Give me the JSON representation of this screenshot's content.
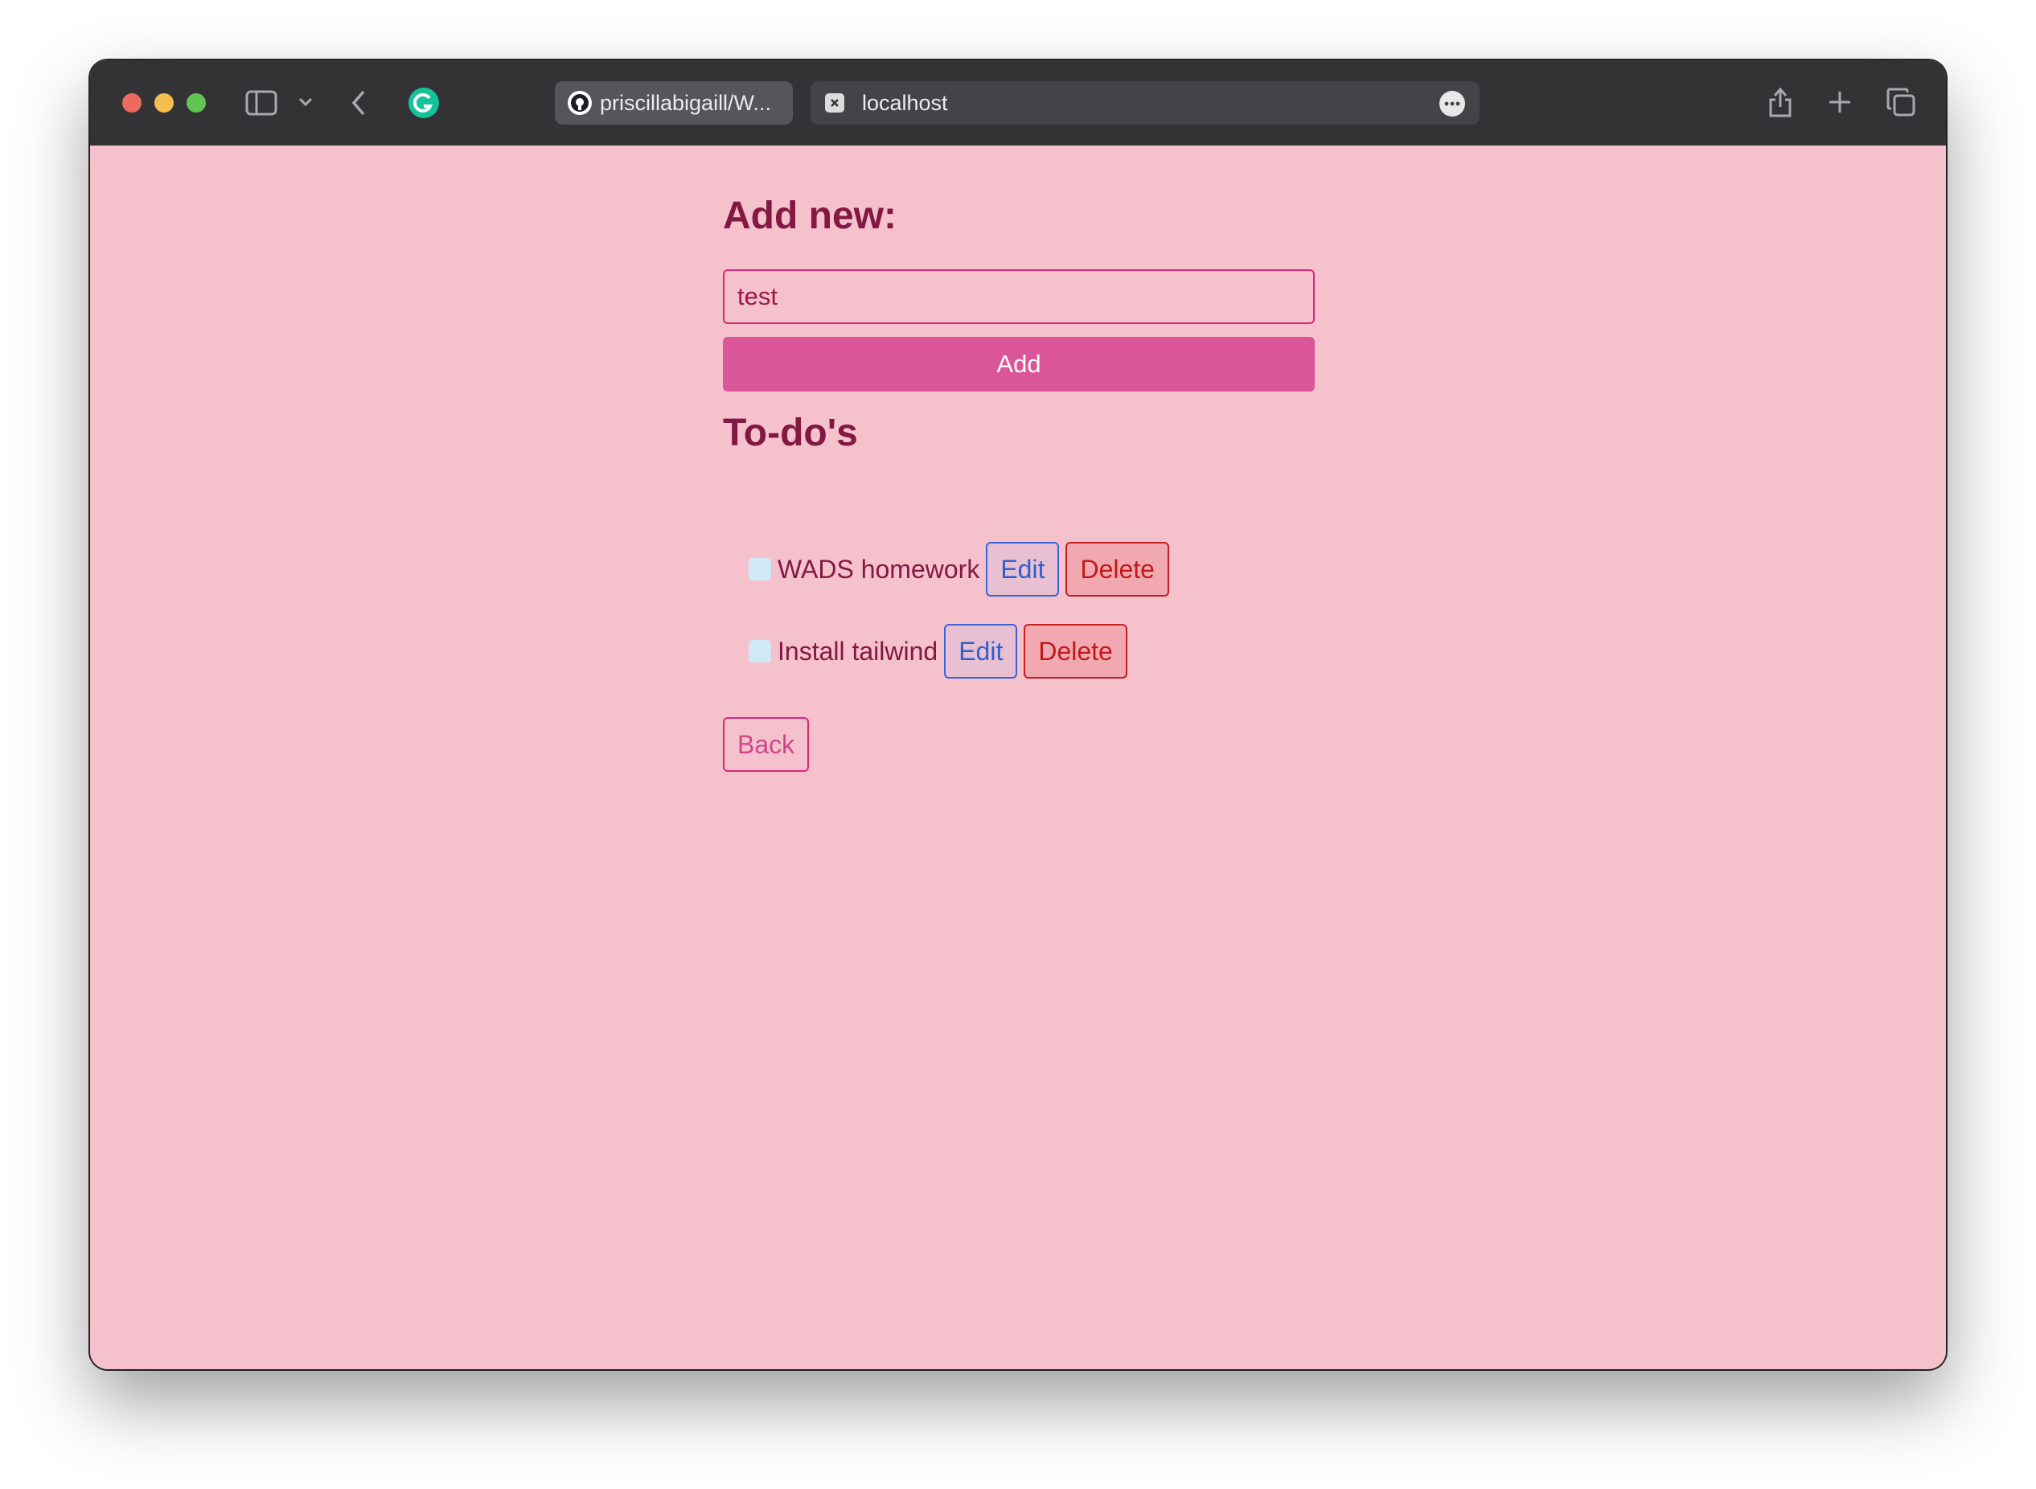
{
  "browser": {
    "tabs": [
      {
        "label": "priscillabigaill/W..."
      },
      {
        "label": "localhost"
      }
    ],
    "icons": {
      "sidebar": "sidebar-icon",
      "chevron": "chevron-down-icon",
      "back": "back-arrow-icon",
      "extension": "grammarly-icon",
      "share": "share-icon",
      "new_tab": "plus-icon",
      "tab_overview": "tabs-overview-icon"
    }
  },
  "page": {
    "add_heading": "Add new:",
    "input_value": "test",
    "add_button": "Add",
    "todos_heading": "To-do's",
    "todos": [
      {
        "text": "WADS homework",
        "done": false,
        "edit_label": "Edit",
        "delete_label": "Delete"
      },
      {
        "text": "Install tailwind",
        "done": false,
        "edit_label": "Edit",
        "delete_label": "Delete"
      }
    ],
    "back_button": "Back"
  },
  "colors": {
    "background": "#f4c1cc",
    "heading": "#831843",
    "accent": "#db5599",
    "edit": "#2f5fcf",
    "delete": "#c21818"
  }
}
